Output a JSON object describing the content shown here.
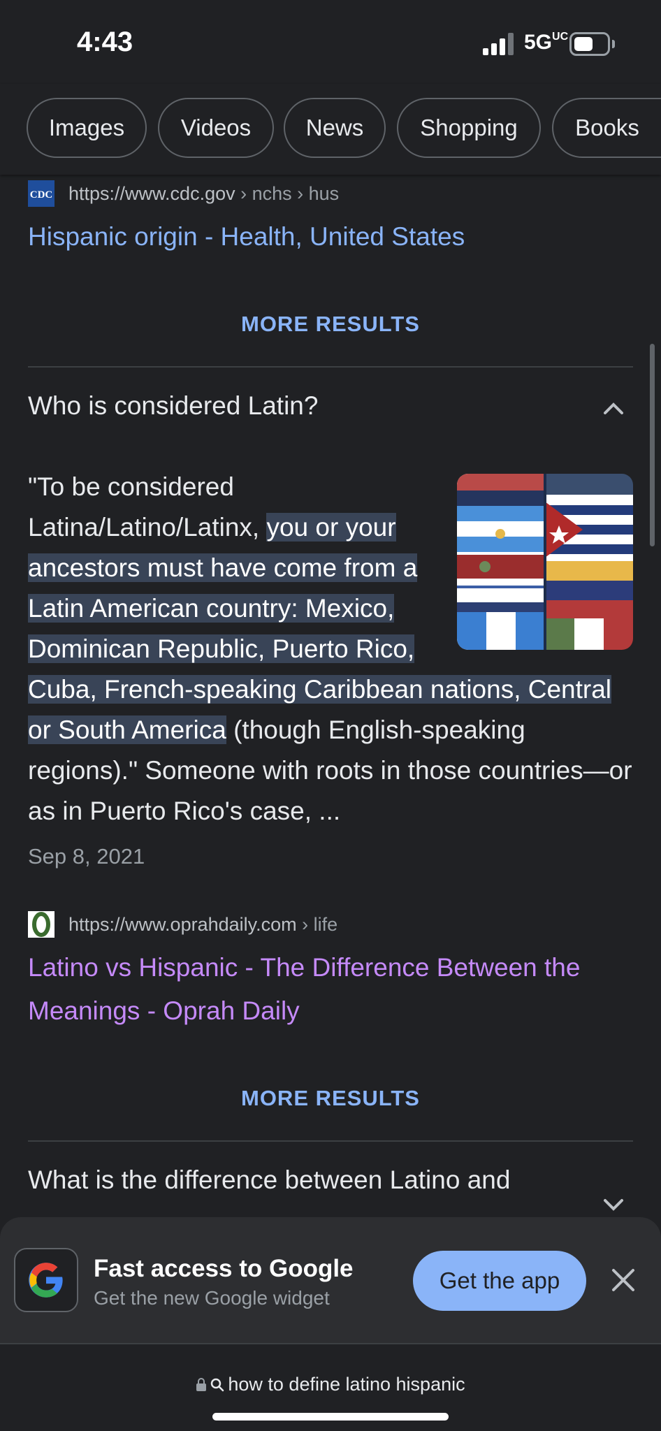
{
  "status": {
    "time": "4:43",
    "network": "5G",
    "network_suffix": "UC"
  },
  "chips": [
    "Images",
    "Videos",
    "News",
    "Shopping",
    "Books"
  ],
  "result1": {
    "site_url": "https://www.cdc.gov",
    "site_path": " › nchs › hus",
    "favicon_label": "CDC",
    "title": "Hispanic origin - Health, United States"
  },
  "more_results_label": "MORE RESULTS",
  "question1": {
    "text": "Who is considered Latin?",
    "snippet_pre": "\"To be considered Latina/Latino/Latinx, ",
    "snippet_highlight": "you or your ancestors must have come from a Latin American country: Mexico, Dominican Republic, Puerto Rico, Cuba, French-speaking Caribbean nations, Central or South America",
    "snippet_post": " (though English-speaking regions).\" Someone with roots in those countries—or as in Puerto Rico's case, ...",
    "date": "Sep 8, 2021"
  },
  "result2": {
    "site_url": "https://www.oprahdaily.com",
    "site_path": " › life",
    "title_line1": "Latino vs Hispanic - The Difference Between the",
    "title_line2": "Meanings - Oprah Daily"
  },
  "question2": {
    "text": "What is the difference between Latino and"
  },
  "promo": {
    "title": "Fast access to Google",
    "subtitle": "Get the new Google widget",
    "button": "Get the app"
  },
  "address_bar": {
    "query": "how to define latino hispanic"
  },
  "colors": {
    "background": "#202124",
    "link_blue": "#8ab4f8",
    "visited_purple": "#c58af9",
    "highlight": "#394457"
  }
}
